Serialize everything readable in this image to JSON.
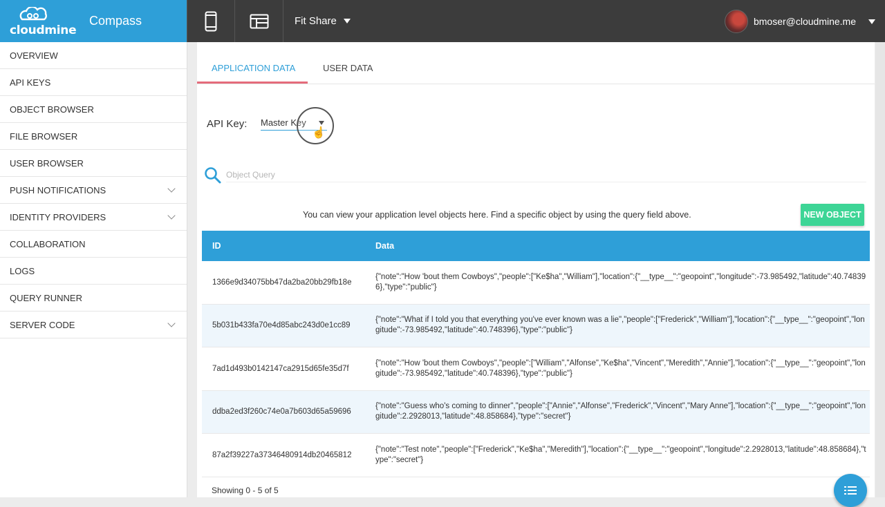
{
  "brand": {
    "logo_text": "cloudmine",
    "app_name": "Compass"
  },
  "topbar": {
    "app_selected": "Fit Share",
    "user_email": "bmoser@cloudmine.me"
  },
  "sidebar": {
    "items": [
      {
        "label": "OVERVIEW",
        "expandable": false
      },
      {
        "label": "API KEYS",
        "expandable": false
      },
      {
        "label": "OBJECT BROWSER",
        "expandable": false
      },
      {
        "label": "FILE BROWSER",
        "expandable": false
      },
      {
        "label": "USER BROWSER",
        "expandable": false
      },
      {
        "label": "PUSH NOTIFICATIONS",
        "expandable": true
      },
      {
        "label": "IDENTITY PROVIDERS",
        "expandable": true
      },
      {
        "label": "COLLABORATION",
        "expandable": false
      },
      {
        "label": "LOGS",
        "expandable": false
      },
      {
        "label": "QUERY RUNNER",
        "expandable": false
      },
      {
        "label": "SERVER CODE",
        "expandable": true
      }
    ]
  },
  "tabs": {
    "application_data": "APPLICATION DATA",
    "user_data": "USER DATA"
  },
  "api_key": {
    "label": "API Key:",
    "selected": "Master Key"
  },
  "search": {
    "placeholder": "Object Query"
  },
  "info_text": "You can view your application level objects here. Find a specific object by using the query field above.",
  "new_object_label": "NEW OBJECT",
  "table": {
    "headers": {
      "id": "ID",
      "data": "Data"
    },
    "rows": [
      {
        "id": "1366e9d34075bb47da2ba20bb29fb18e",
        "data": "{\"note\":\"How 'bout them Cowboys\",\"people\":[\"Ke$ha\",\"William\"],\"location\":{\"__type__\":\"geopoint\",\"longitude\":-73.985492,\"latitude\":40.748396},\"type\":\"public\"}"
      },
      {
        "id": "5b031b433fa70e4d85abc243d0e1cc89",
        "data": "{\"note\":\"What if I told you that everything you've ever known was a lie\",\"people\":[\"Frederick\",\"William\"],\"location\":{\"__type__\":\"geopoint\",\"longitude\":-73.985492,\"latitude\":40.748396},\"type\":\"public\"}"
      },
      {
        "id": "7ad1d493b0142147ca2915d65fe35d7f",
        "data": "{\"note\":\"How 'bout them Cowboys\",\"people\":[\"William\",\"Alfonse\",\"Ke$ha\",\"Vincent\",\"Meredith\",\"Annie\"],\"location\":{\"__type__\":\"geopoint\",\"longitude\":-73.985492,\"latitude\":40.748396},\"type\":\"public\"}"
      },
      {
        "id": "ddba2ed3f260c74e0a7b603d65a59696",
        "data": "{\"note\":\"Guess who's coming to dinner\",\"people\":[\"Annie\",\"Alfonse\",\"Frederick\",\"Vincent\",\"Mary Anne\"],\"location\":{\"__type__\":\"geopoint\",\"longitude\":2.2928013,\"latitude\":48.858684},\"type\":\"secret\"}"
      },
      {
        "id": "87a2f39227a37346480914db20465812",
        "data": "{\"note\":\"Test note\",\"people\":[\"Frederick\",\"Ke$ha\",\"Meredith\"],\"location\":{\"__type__\":\"geopoint\",\"longitude\":2.2928013,\"latitude\":48.858684},\"type\":\"secret\"}"
      }
    ]
  },
  "showing": "Showing 0 - 5 of 5",
  "colors": {
    "brand_blue": "#2e9fd8",
    "topbar": "#3c3c3c",
    "new_button": "#3dd596",
    "tab_underline": "#e46b7b"
  },
  "icons": [
    "mobile-device-icon",
    "layout-icon",
    "search-icon",
    "list-icon",
    "chevron-down-icon"
  ]
}
